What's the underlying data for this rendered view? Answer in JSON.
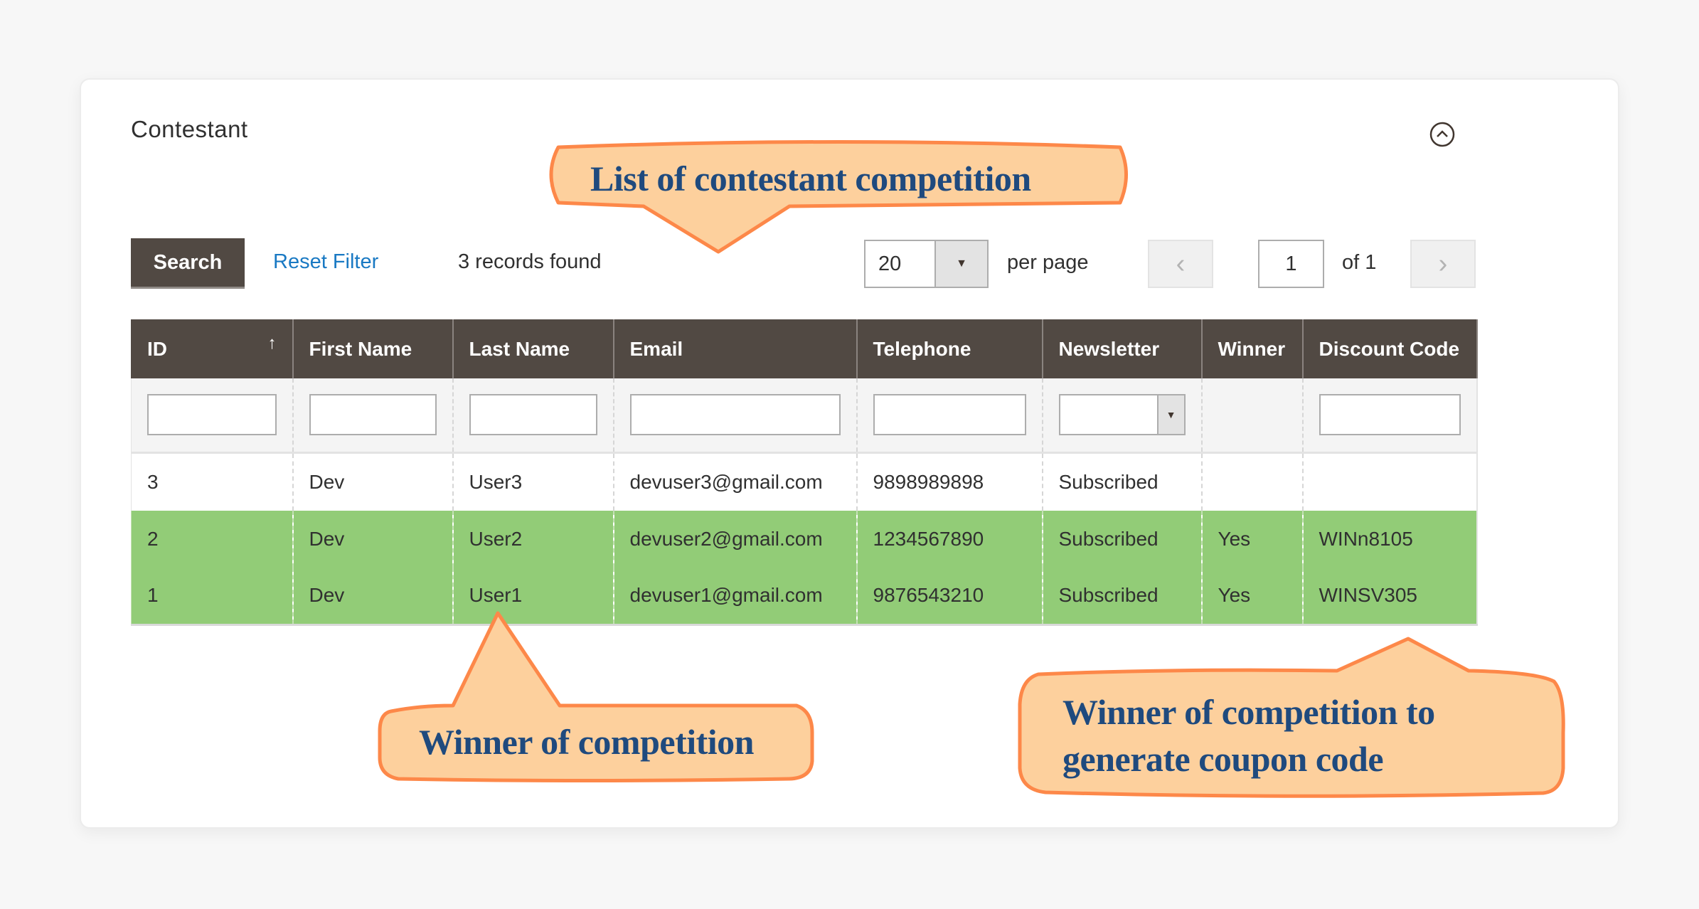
{
  "panel": {
    "title": "Contestant",
    "collapse_icon": "chevron-up-circle-icon"
  },
  "toolbar": {
    "search_label": "Search",
    "reset_label": "Reset Filter",
    "records_text": "3 records found",
    "per_page_value": "20",
    "per_page_label": "per page",
    "page_current": "1",
    "page_of": "of 1",
    "prev_icon": "‹",
    "next_icon": "›",
    "dropdown_icon": "▼"
  },
  "table": {
    "columns": [
      {
        "label": "ID",
        "sort_icon": "↑"
      },
      {
        "label": "First Name"
      },
      {
        "label": "Last Name"
      },
      {
        "label": "Email"
      },
      {
        "label": "Telephone"
      },
      {
        "label": "Newsletter"
      },
      {
        "label": "Winner"
      },
      {
        "label": "Discount Code"
      }
    ],
    "rows": [
      {
        "id": "3",
        "first_name": "Dev",
        "last_name": "User3",
        "email": "devuser3@gmail.com",
        "telephone": "9898989898",
        "newsletter": "Subscribed",
        "winner": "",
        "discount_code": "",
        "highlight": false
      },
      {
        "id": "2",
        "first_name": "Dev",
        "last_name": "User2",
        "email": "devuser2@gmail.com",
        "telephone": "1234567890",
        "newsletter": "Subscribed",
        "winner": "Yes",
        "discount_code": "WINn8105",
        "highlight": true
      },
      {
        "id": "1",
        "first_name": "Dev",
        "last_name": "User1",
        "email": "devuser1@gmail.com",
        "telephone": "9876543210",
        "newsletter": "Subscribed",
        "winner": "Yes",
        "discount_code": "WINSV305",
        "highlight": true
      }
    ],
    "winner_row_color": "#92cc77",
    "header_color": "#514943"
  },
  "annotations": {
    "list_callout": "List of contestant competition",
    "winner_callout": "Winner of competition",
    "coupon_callout_line1": "Winner of competition to",
    "coupon_callout_line2": "generate coupon code",
    "fill_color": "#fdd09d",
    "stroke_color": "#fd8849",
    "text_color": "#1f4a7e"
  }
}
